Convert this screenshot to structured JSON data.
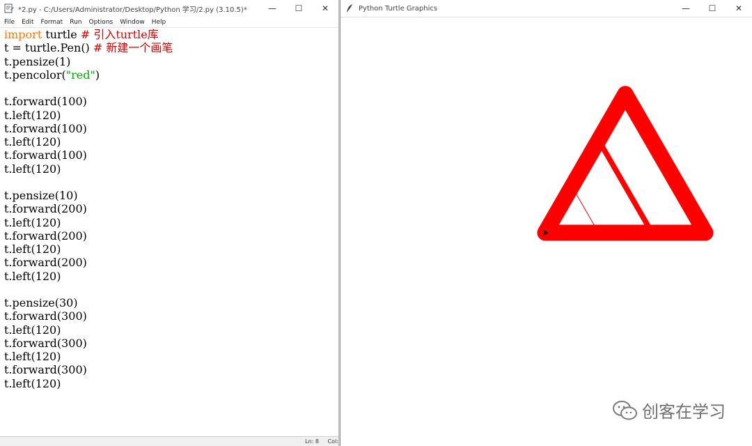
{
  "idle_window": {
    "title": "*2.py - C:/Users/Administrator/Desktop/Python 学习/2.py (3.10.5)*",
    "menu": [
      "File",
      "Edit",
      "Format",
      "Run",
      "Options",
      "Window",
      "Help"
    ],
    "code_lines": [
      [
        {
          "t": "import",
          "c": "kw"
        },
        {
          "t": " turtle "
        },
        {
          "t": "# 引入turtle库",
          "c": "cm"
        }
      ],
      [
        {
          "t": "t = turtle.Pen() "
        },
        {
          "t": "# 新建一个画笔",
          "c": "cm"
        }
      ],
      [
        {
          "t": "t.pensize(1)"
        }
      ],
      [
        {
          "t": "t.pencolor("
        },
        {
          "t": "\"red\"",
          "c": "st"
        },
        {
          "t": ")"
        }
      ],
      [],
      [
        {
          "t": "t.forward(100)"
        }
      ],
      [
        {
          "t": "t.left(120)"
        }
      ],
      [
        {
          "t": "t.forward(100)"
        }
      ],
      [
        {
          "t": "t.left(120)"
        }
      ],
      [
        {
          "t": "t.forward(100)"
        }
      ],
      [
        {
          "t": "t.left(120)"
        }
      ],
      [],
      [
        {
          "t": "t.pensize(10)"
        }
      ],
      [
        {
          "t": "t.forward(200)"
        }
      ],
      [
        {
          "t": "t.left(120)"
        }
      ],
      [
        {
          "t": "t.forward(200)"
        }
      ],
      [
        {
          "t": "t.left(120)"
        }
      ],
      [
        {
          "t": "t.forward(200)"
        }
      ],
      [
        {
          "t": "t.left(120)"
        }
      ],
      [],
      [
        {
          "t": "t.pensize(30)"
        }
      ],
      [
        {
          "t": "t.forward(300)"
        }
      ],
      [
        {
          "t": "t.left(120)"
        }
      ],
      [
        {
          "t": "t.forward(300)"
        }
      ],
      [
        {
          "t": "t.left(120)"
        }
      ],
      [
        {
          "t": "t.forward(300)"
        }
      ],
      [
        {
          "t": "t.left(120)"
        }
      ]
    ],
    "status": {
      "line": "Ln: 8",
      "col": "Col:"
    }
  },
  "turtle_window": {
    "title": "Python Turtle Graphics",
    "pen_color": "#ff0000",
    "triangles": [
      {
        "side": 100,
        "pensize": 1
      },
      {
        "side": 200,
        "pensize": 10
      },
      {
        "side": 300,
        "pensize": 30
      }
    ]
  },
  "window_controls": {
    "minimize": "—",
    "maximize": "☐",
    "close": "✕"
  },
  "watermark": {
    "text": "创客在学习",
    "icon": "wechat-icon"
  }
}
